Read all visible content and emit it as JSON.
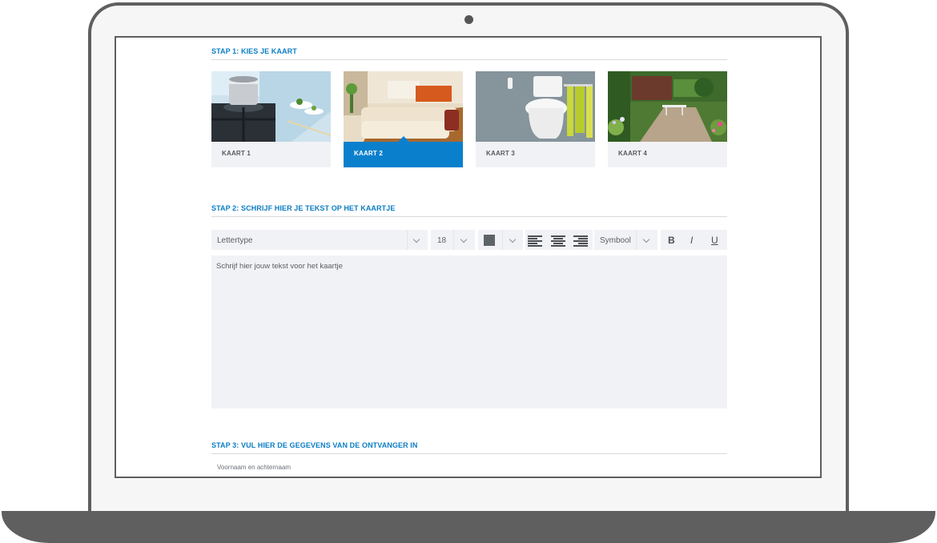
{
  "step1": {
    "title": "STAP 1: KIES JE KAART"
  },
  "cards": [
    {
      "label": "KAART 1",
      "image": "kitchen-photo",
      "selected": false
    },
    {
      "label": "KAART 2",
      "image": "living-room-photo",
      "selected": true
    },
    {
      "label": "KAART 3",
      "image": "bathroom-photo",
      "selected": false
    },
    {
      "label": "KAART 4",
      "image": "garden-photo",
      "selected": false
    }
  ],
  "step2": {
    "title": "STAP 2: SCHRIJF HIER JE TEKST OP HET KAARTJE"
  },
  "toolbar": {
    "font_select": "Lettertype",
    "size_select": "18",
    "color_swatch": "#5d6468",
    "symbol_select": "Symbool",
    "bold": "B",
    "italic": "I",
    "underline": "U"
  },
  "editor": {
    "placeholder": "Schrijf hier jouw tekst voor het kaartje"
  },
  "step3": {
    "title": "STAP 3: VUL HIER DE GEGEVENS VAN DE ONTVANGER IN",
    "name_label": "Voornaam en achternaam"
  },
  "colors": {
    "accent": "#0a80cc",
    "frame": "#5f5f5f",
    "panel": "#f1f2f5"
  }
}
